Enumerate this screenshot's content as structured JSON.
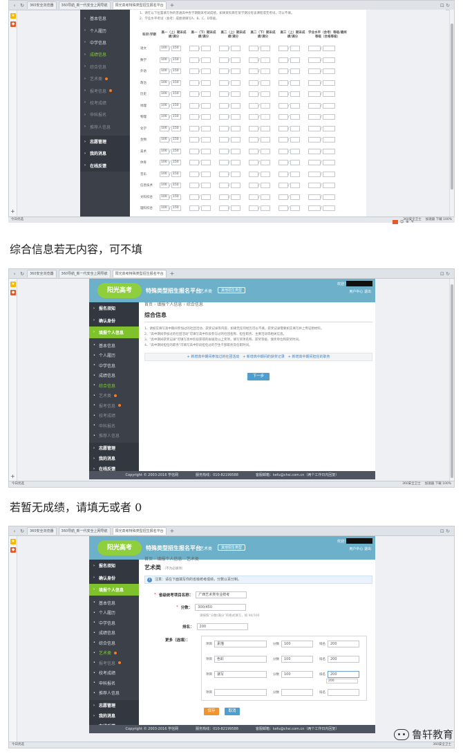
{
  "captions": {
    "after_shot1": "综合信息若无内容，可不填",
    "after_shot2": "若暂无成绩，请填无或者 0"
  },
  "watermark": "鲁轩教育",
  "browser": {
    "tabs": [
      {
        "label": "360安全浏览器"
      },
      {
        "label": "360导航_新一代安全上网导航"
      },
      {
        "label": "阳光高考特殊类型招生报名平台"
      }
    ],
    "status_left": "今日优选",
    "status_mid": "360安全卫士",
    "status_right": "加速器   下载   100%"
  },
  "header": {
    "logo": "阳光高考",
    "platform": "特殊类型招生报名平台",
    "type": "艺术类",
    "switch": "其他招生类型",
    "welcome": "欢迎！",
    "links": "用户中心   退出"
  },
  "sidebar_top": [
    {
      "label": "报名须知",
      "bold": true
    },
    {
      "label": "确认身份",
      "bold": true
    },
    {
      "label": "填报个人信息",
      "bold": true
    }
  ],
  "sidebar_sub": [
    {
      "label": "基本信息"
    },
    {
      "label": "个人履历"
    },
    {
      "label": "中学信息"
    },
    {
      "label": "成绩信息"
    },
    {
      "label": "综合信息"
    },
    {
      "label": "艺术类"
    },
    {
      "label": "报考信息"
    },
    {
      "label": "校考成绩"
    },
    {
      "label": "申科报名"
    },
    {
      "label": "推荐人信息"
    }
  ],
  "sidebar_bottom": [
    {
      "label": "志愿管理"
    },
    {
      "label": "我的消息"
    },
    {
      "label": "在线反馈"
    }
  ],
  "shot1": {
    "notes": [
      "1、请在以下位置填写你的普通高中各学期期末考试成绩，如果某科目在某学期没有该课程或无考试，可以不填。",
      "2、学业水平考试（会考）成绩请填写A、B、C、D等级。"
    ],
    "columns": [
      "科目\\学期",
      "高一（上）期末成绩/满分",
      "高一（下）期末成绩/满分",
      "高二（上）期末成绩/满分",
      "高二（下）期末成绩/满分",
      "高三（上）期末成绩/满分",
      "学业水平（会考）等级/最终等级（合格等级）"
    ],
    "subjects": [
      "语文",
      "数学",
      "外语",
      "政治",
      "历史",
      "地理",
      "物理",
      "化学",
      "生物",
      "美术",
      "体育",
      "音乐",
      "信息技术",
      "文科综合",
      "理科综合"
    ],
    "sample_score": "100",
    "sample_full": "150"
  },
  "shot2": {
    "breadcrumb": [
      "首页",
      "填报个人信息",
      "综合信息"
    ],
    "title": "综合信息",
    "notes": [
      "1、请如实填写高中期间参加过的社团活动、获奖记录等内容，如果无任何经历可以不填，获奖记录需要如实填写并上传证明材料。",
      "2、\"高中期间参加过的社团活动\"可填写高中阶段参与过的社团名称、担任职务、主要活动等相关信息。",
      "3、\"高中期间获奖记录\"可填写高中阶段获得的省级及以上奖项，填写奖项名称、获奖等级、颁奖单位和获奖时间。",
      "4、\"高中期间担任的职务\"可填写高中阶段担任过的学生干部职务及任职时间。"
    ],
    "links": [
      "+ 新增高中期间参加过的社团活动",
      "+ 新增高中期间的获奖记录",
      "+ 新增高中期间担任的职务"
    ],
    "next": "下一步",
    "copyright": "Copyright © 2003-2016 学信网",
    "hotline": "服务热线：010-82199588",
    "email": "客服邮箱：kefu@chsi.com.cn（两个工作日内回复）"
  },
  "shot3": {
    "breadcrumb": [
      "首页",
      "填报个人信息",
      "艺术类"
    ],
    "title": "艺术类",
    "title_small": "（不为必填项）",
    "tip": "注意：请在下面填写你的省级统考成绩，分数以百分制。",
    "project_label": "省级统考项目名称：",
    "project_value": "广西艺术类专业统考",
    "score_label": "分数：",
    "score_value": "300/450",
    "score_help": "请按照“分数/满分”的格式填写，如 90/100",
    "rank_label": "排名：",
    "rank_value": "200",
    "more_label": "更多（选填）：",
    "more_rows": [
      {
        "item_label": "项目",
        "item": "素描",
        "score_label": "分数",
        "score": "100",
        "rank_label": "排名",
        "rank": "200"
      },
      {
        "item_label": "项目",
        "item": "色彩",
        "score_label": "分数",
        "score": "100",
        "rank_label": "排名",
        "rank": "200"
      },
      {
        "item_label": "项目",
        "item": "速写",
        "score_label": "分数",
        "score": "100",
        "rank_label": "排名",
        "rank": "200"
      },
      {
        "item_label": "项目",
        "item": "",
        "score_label": "分数",
        "score": "",
        "rank_label": "排名",
        "rank": ""
      }
    ],
    "autocomplete": "200",
    "save": "保存",
    "cancel": "取消"
  }
}
